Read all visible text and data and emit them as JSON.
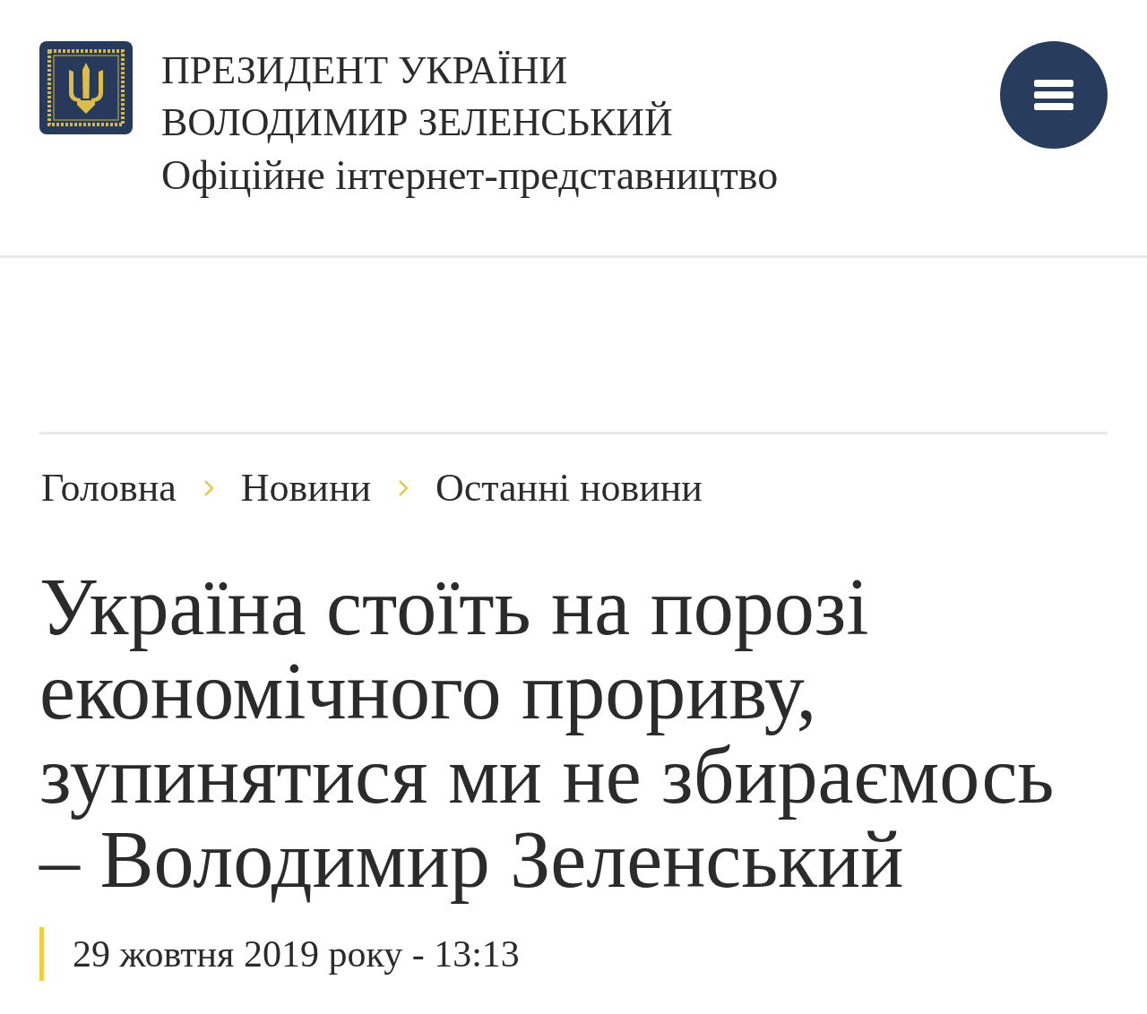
{
  "header": {
    "title_lines": [
      "ПРЕЗИДЕНТ УКРАЇНИ",
      "ВОЛОДИМИР ЗЕЛЕНСЬКИЙ"
    ],
    "subtitle": "Офіційне інтернет-представництво"
  },
  "breadcrumbs": [
    {
      "label": "Головна"
    },
    {
      "label": "Новини"
    },
    {
      "label": "Останні новини"
    }
  ],
  "article": {
    "title_lines": [
      "Україна стоїть на порозі",
      "економічного прориву,",
      "зупинятися ми не збираємось",
      "– Володимир Зеленський"
    ],
    "date": "29 жовтня 2019 року - 13:13"
  }
}
